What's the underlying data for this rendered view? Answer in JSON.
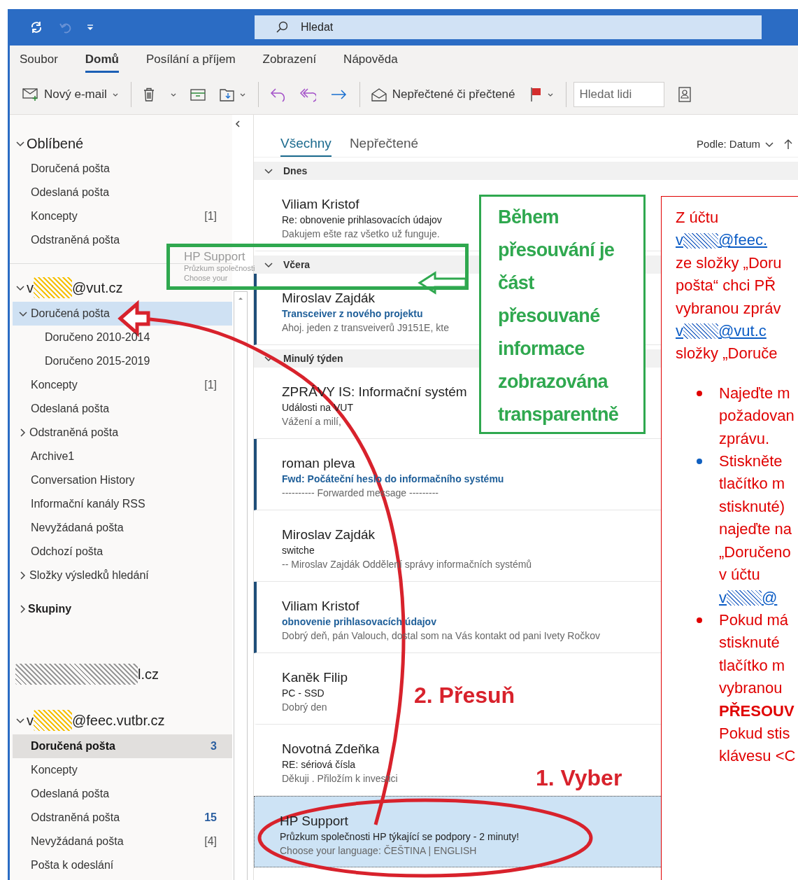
{
  "title_bar": {
    "search_placeholder": "Hledat"
  },
  "menu_tabs": [
    {
      "label": "Soubor",
      "selected": false
    },
    {
      "label": "Domů",
      "selected": true
    },
    {
      "label": "Posílání a příjem",
      "selected": false
    },
    {
      "label": "Zobrazení",
      "selected": false
    },
    {
      "label": "Nápověda",
      "selected": false
    }
  ],
  "toolbar": {
    "new_email": "Nový e-mail",
    "read_toggle": "Nepřečtené či přečtené",
    "people_search": {
      "placeholder": "Hledat lidi"
    }
  },
  "sidebar": {
    "sections": [
      {
        "kind": "header",
        "label": "Oblíbené",
        "expanded": true,
        "folders": [
          {
            "label": "Doručená pošta",
            "selected": false,
            "drop_target": false
          },
          {
            "label": "Odeslaná pošta",
            "selected": false,
            "drop_target": false
          },
          {
            "label": "Koncepty",
            "count": "[1]",
            "count_unread": false,
            "selected": false,
            "drop_target": false
          },
          {
            "label": "Odstraněná pošta",
            "selected": false,
            "drop_target": false
          }
        ]
      },
      {
        "kind": "account",
        "prefix": "v",
        "suffix": "@vut.cz",
        "color": "#f6c000",
        "expanded": true,
        "folders": [
          {
            "label": "Doručená pošta",
            "expanded": true,
            "selected": false,
            "drop_target": true,
            "children": [
              {
                "label": "Doručeno 2010-2014",
                "selected": false,
                "drop_target": false
              },
              {
                "label": "Doručeno 2015-2019",
                "selected": false,
                "drop_target": false
              }
            ]
          },
          {
            "label": "Koncepty",
            "count": "[1]",
            "count_unread": false,
            "selected": false,
            "drop_target": false
          },
          {
            "label": "Odeslaná pošta",
            "selected": false,
            "drop_target": false
          },
          {
            "label": "Odstraněná pošta",
            "expanded": false,
            "selected": false,
            "drop_target": false
          },
          {
            "label": "Archive1",
            "selected": false,
            "drop_target": false
          },
          {
            "label": "Conversation History",
            "selected": false,
            "drop_target": false
          },
          {
            "label": "Informační kanály RSS",
            "selected": false,
            "drop_target": false
          },
          {
            "label": "Nevyžádaná pošta",
            "selected": false,
            "drop_target": false
          },
          {
            "label": "Odchozí pošta",
            "selected": false,
            "drop_target": false
          },
          {
            "label": "Složky výsledků hledání",
            "expanded": false,
            "selected": false,
            "drop_target": false
          }
        ]
      },
      {
        "kind": "group",
        "label": "Skupiny",
        "expanded": false
      },
      {
        "kind": "account",
        "suffix": "l.cz",
        "color": "#9a9a9a"
      },
      {
        "kind": "account",
        "prefix": "v",
        "suffix": "@feec.vutbr.cz",
        "color": "#f6c000",
        "expanded": true,
        "folders": [
          {
            "label": "Doručená pošta",
            "bold": true,
            "count": "3",
            "count_unread": true,
            "selected": true,
            "drop_target": false
          },
          {
            "label": "Koncepty",
            "selected": false,
            "drop_target": false
          },
          {
            "label": "Odeslaná pošta",
            "selected": false,
            "drop_target": false
          },
          {
            "label": "Odstraněná pošta",
            "count": "15",
            "count_unread": true,
            "selected": false,
            "drop_target": false
          },
          {
            "label": "Nevyžádaná pošta",
            "count": "[4]",
            "count_unread": false,
            "selected": false,
            "drop_target": false
          },
          {
            "label": "Pošta k odeslání",
            "selected": false,
            "drop_target": false
          }
        ]
      }
    ]
  },
  "message_list": {
    "tabs": [
      {
        "label": "Všechny",
        "selected": true
      },
      {
        "label": "Nepřečtené",
        "selected": false
      }
    ],
    "sort": "Podle: Datum",
    "groups": [
      {
        "label": "Dnes",
        "expanded": true,
        "messages": [
          {
            "sender": "Viliam Kristof",
            "subject": "Re: obnovenie prihlasovacích údajov",
            "preview": "Dakujem ešte raz všetko už funguje.",
            "unread": false,
            "selected": false
          }
        ]
      },
      {
        "label": "Včera",
        "expanded": true,
        "messages": [
          {
            "sender": "Miroslav Zajdák",
            "subject": "Transceiver z nového projektu",
            "preview": "Ahoj.  jeden z transveiverů J9151E, kte",
            "unread": true,
            "selected": false
          }
        ]
      },
      {
        "label": "Minulý týden",
        "expanded": true,
        "messages": [
          {
            "sender": "ZPRÁVY IS: Informační systém",
            "subject": "Události na VUT",
            "preview": "Vážení a milí,",
            "unread": false,
            "selected": false
          },
          {
            "sender": "roman pleva",
            "subject": "Fwd: Počáteční heslo do informačního systému",
            "preview": "---------- Forwarded message ---------",
            "unread": true,
            "selected": false
          },
          {
            "sender": "Miroslav Zajdák",
            "subject": "switche",
            "preview": "--  Miroslav Zajdák  Oddělení správy informačních systémů",
            "unread": false,
            "selected": false
          },
          {
            "sender": "Viliam Kristof",
            "subject": "obnovenie prihlasovacích údajov",
            "preview": "Dobrý deň,  pán Valouch, dostal som na Vás kontakt od pani Ivety Ročkov",
            "unread": true,
            "selected": false
          },
          {
            "sender": "Kaněk Filip",
            "subject": "PC - SSD",
            "preview": "Dobrý den",
            "unread": false,
            "selected": false
          },
          {
            "sender": "Novotná Zdeňka",
            "subject": "RE: sériová čísla",
            "preview": "Děkuji .  Přiložím k investici",
            "unread": false,
            "selected": false
          },
          {
            "sender": "HP Support",
            "subject": "Průzkum společnosti HP týkající se podpory - 2 minuty!",
            "preview": "Choose your language: ČEŠTINA | ENGLISH",
            "unread": false,
            "selected": true
          }
        ]
      }
    ]
  },
  "drag_preview": {
    "sender": "HP Support",
    "subject": "Průzkum společnosti",
    "preview": "Choose your"
  },
  "annotations": {
    "note": "Během přesouvání je část přesouvané informace zobrazována transparentně",
    "steps": [
      {
        "label": "1. Vyber"
      },
      {
        "label": "2. Přesuň"
      }
    ],
    "instructions": {
      "intro": [
        {
          "kind": "text",
          "text": "Z účtu"
        },
        {
          "kind": "account_link",
          "prefix": "v",
          "text": "@feec."
        },
        {
          "kind": "text",
          "text": "ze složky „Doru"
        },
        {
          "kind": "text",
          "text": "pošta“ chci PŘ"
        },
        {
          "kind": "text",
          "text": "vybranou zpráv"
        },
        {
          "kind": "account_link",
          "prefix": "v",
          "text": "@vut.c"
        },
        {
          "kind": "text",
          "text": "složky „Doruče"
        }
      ],
      "bullets": [
        {
          "color": "#e00000",
          "lines": [
            {
              "kind": "text",
              "text": "Najeďte m"
            },
            {
              "kind": "text",
              "text": "požadovan"
            },
            {
              "kind": "text",
              "text": "zprávu."
            }
          ]
        },
        {
          "color": "#1060c0",
          "lines": [
            {
              "kind": "text",
              "text": "Stiskněte"
            },
            {
              "kind": "text",
              "text": "tlačítko m"
            },
            {
              "kind": "text",
              "text": "stisknuté)"
            },
            {
              "kind": "text",
              "text": "najeďte na"
            },
            {
              "kind": "text",
              "text": "„Doručeno"
            },
            {
              "kind": "text",
              "text": "v účtu"
            },
            {
              "kind": "account_link",
              "prefix": "v",
              "text": "@"
            }
          ]
        },
        {
          "color": "#e00000",
          "lines": [
            {
              "kind": "text",
              "text": "Pokud má"
            },
            {
              "kind": "text",
              "text": "stisknuté"
            },
            {
              "kind": "text",
              "text": "tlačítko m"
            },
            {
              "kind": "text",
              "text": "vybranou"
            },
            {
              "kind": "bold",
              "text": "PŘESOUV"
            },
            {
              "kind": "text",
              "text": "Pokud stis"
            },
            {
              "kind": "text",
              "text": "klávesu <C"
            }
          ]
        }
      ]
    }
  }
}
